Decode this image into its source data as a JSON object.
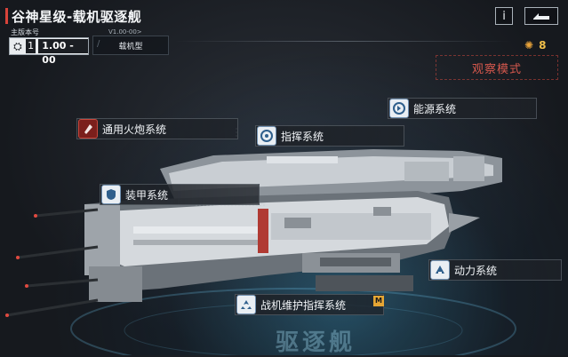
{
  "header": {
    "title": "谷神星级-载机驱逐舰",
    "info_label": "i",
    "count": "8"
  },
  "version": {
    "label": "主版本号",
    "major": "1",
    "minor": "1.00 - 00",
    "small": "V1.00-00>",
    "type": "载机型"
  },
  "observe_mode": "观察模式",
  "systems": [
    {
      "label": "通用火炮系统",
      "icon": "shell-icon"
    },
    {
      "label": "指挥系统",
      "icon": "command-icon"
    },
    {
      "label": "能源系统",
      "icon": "energy-icon"
    },
    {
      "label": "装甲系统",
      "icon": "shield-icon"
    },
    {
      "label": "动力系统",
      "icon": "engine-icon"
    },
    {
      "label": "战机维护指挥系统",
      "icon": "aircraft-icon"
    }
  ],
  "floor_text": "驱逐舰",
  "colors": {
    "accent": "#d8433a",
    "badge": "#e8a33a",
    "highlight": "#2f7fc0"
  }
}
